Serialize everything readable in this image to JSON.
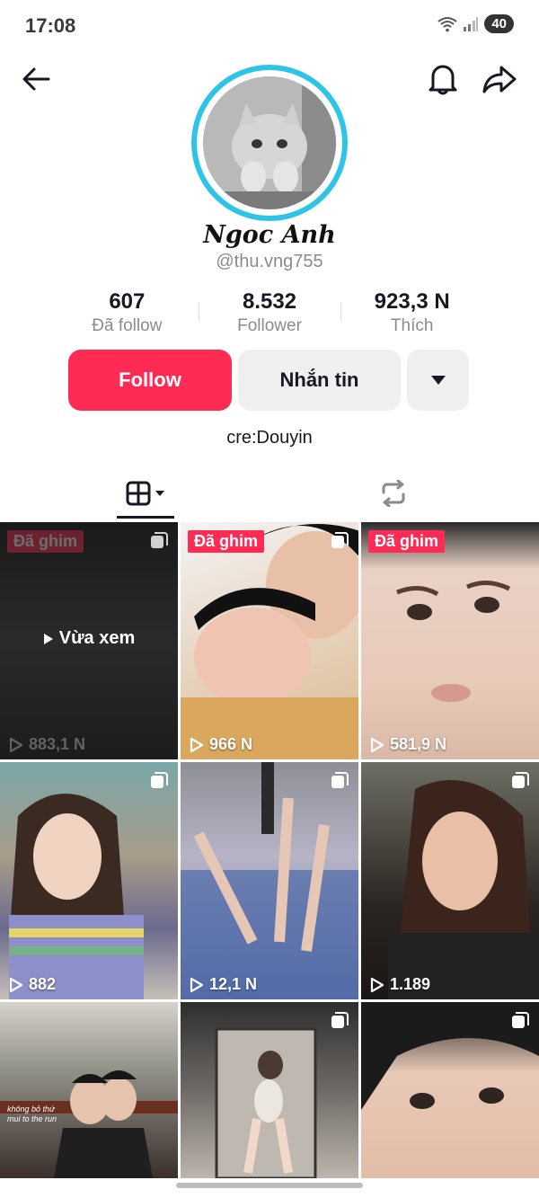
{
  "status_bar": {
    "time": "17:08",
    "battery": "40"
  },
  "profile": {
    "display_name": "Ngoc Anh",
    "handle": "@thu.vng755",
    "bio": "cre:Douyin"
  },
  "stats": [
    {
      "value": "607",
      "label": "Đã follow"
    },
    {
      "value": "8.532",
      "label": "Follower"
    },
    {
      "value": "923,3 N",
      "label": "Thích"
    }
  ],
  "actions": {
    "follow_label": "Follow",
    "message_label": "Nhắn tin"
  },
  "videos": [
    {
      "views": "883,1 N",
      "pinned": "Đã ghim",
      "overlay": "Vừa xem"
    },
    {
      "views": "966 N",
      "pinned": "Đã ghim"
    },
    {
      "views": "581,9 N",
      "pinned": "Đã ghim"
    },
    {
      "views": "882"
    },
    {
      "views": "12,1 N"
    },
    {
      "views": "1.189"
    },
    {
      "caption": "không bỏ thứ mui to the run"
    },
    {},
    {}
  ],
  "colors": {
    "accent": "#fe2c55",
    "avatar_ring": "#2ec4e6",
    "secondary_text": "#8a8b91"
  }
}
